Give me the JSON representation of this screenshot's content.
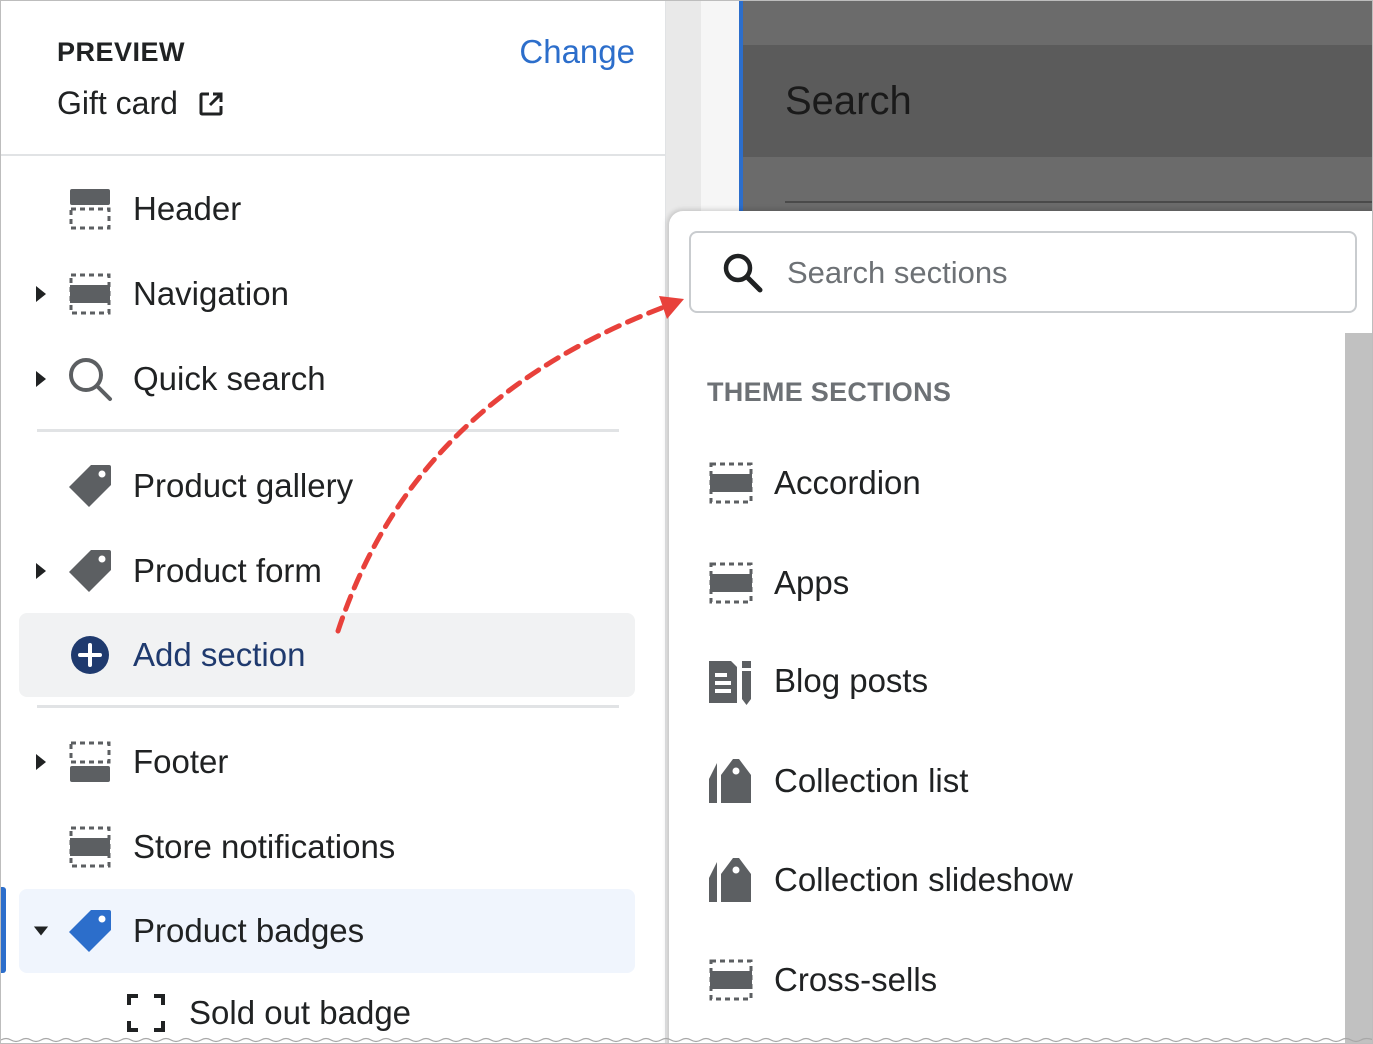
{
  "sidebar": {
    "preview_label": "PREVIEW",
    "preview_value": "Gift card",
    "change_label": "Change",
    "items": [
      {
        "label": "Header",
        "icon": "section-header-icon",
        "caret": ""
      },
      {
        "label": "Navigation",
        "icon": "section-block-icon",
        "caret": "right"
      },
      {
        "label": "Quick search",
        "icon": "search-icon",
        "caret": "right"
      },
      {
        "label": "Product gallery",
        "icon": "tag-icon",
        "caret": ""
      },
      {
        "label": "Product form",
        "icon": "tag-icon",
        "caret": "right"
      },
      {
        "label": "Add section",
        "icon": "plus-circle-icon",
        "caret": ""
      },
      {
        "label": "Footer",
        "icon": "section-footer-icon",
        "caret": "right"
      },
      {
        "label": "Store notifications",
        "icon": "section-block-icon",
        "caret": ""
      },
      {
        "label": "Product badges",
        "icon": "tag-blue-icon",
        "caret": "down"
      },
      {
        "label": "Sold out badge",
        "icon": "block-frame-icon",
        "caret": ""
      }
    ]
  },
  "preview": {
    "title": "Search"
  },
  "popover": {
    "search_placeholder": "Search sections",
    "group_title": "THEME SECTIONS",
    "items": [
      {
        "label": "Accordion",
        "icon": "section-block-icon"
      },
      {
        "label": "Apps",
        "icon": "section-block-icon"
      },
      {
        "label": "Blog posts",
        "icon": "blog-icon"
      },
      {
        "label": "Collection list",
        "icon": "tags-icon"
      },
      {
        "label": "Collection slideshow",
        "icon": "tags-icon"
      },
      {
        "label": "Cross-sells",
        "icon": "section-block-icon"
      }
    ]
  },
  "colors": {
    "accent": "#2c6ecb",
    "add_text": "#1f3a6e",
    "arrow": "#e8413b",
    "icon": "#5c5f62"
  }
}
